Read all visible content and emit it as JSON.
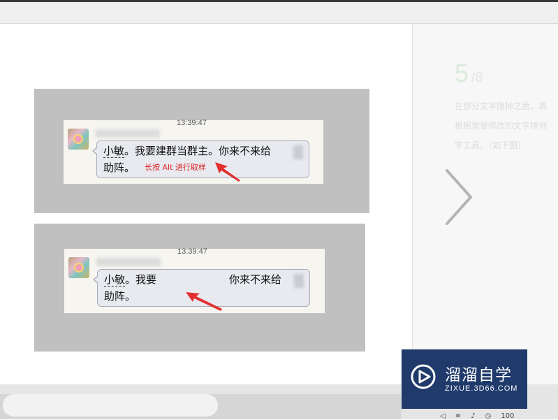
{
  "right_panel": {
    "step_number": "5",
    "step_suffix": "/8",
    "faded_lines": [
      "在部分文字隐掉之后，再",
      "根据需要修改的文字排列",
      "字工具。（如下图）"
    ]
  },
  "screenshot_before": {
    "timestamp": "13:39:47",
    "message_name": "小敏",
    "message_line1_rest": "。我要建群当群主。你来不来给",
    "message_line2": "助阵。",
    "hint": "长按 Alt 进行取样"
  },
  "screenshot_after": {
    "timestamp": "13:39:47",
    "message_name": "小敏",
    "message_line1_start": "。我要",
    "message_line1_end": "你来不来给",
    "message_line2": "助阵。"
  },
  "watermark": {
    "title": "溜溜自学",
    "subtitle": "ZIXUE.3D66.COM"
  },
  "status_bar": {
    "zoom": "100"
  },
  "colors": {
    "slide_gray": "#c0c0c0",
    "bubble_bg": "#e8eaf0",
    "arrow_red": "#e23030",
    "hint_red": "#dd2222",
    "watermark_bg": "#1f3a6b"
  },
  "icons": [
    "next-arrow-icon",
    "play-logo-icon",
    "volume-icon",
    "clock-icon"
  ]
}
